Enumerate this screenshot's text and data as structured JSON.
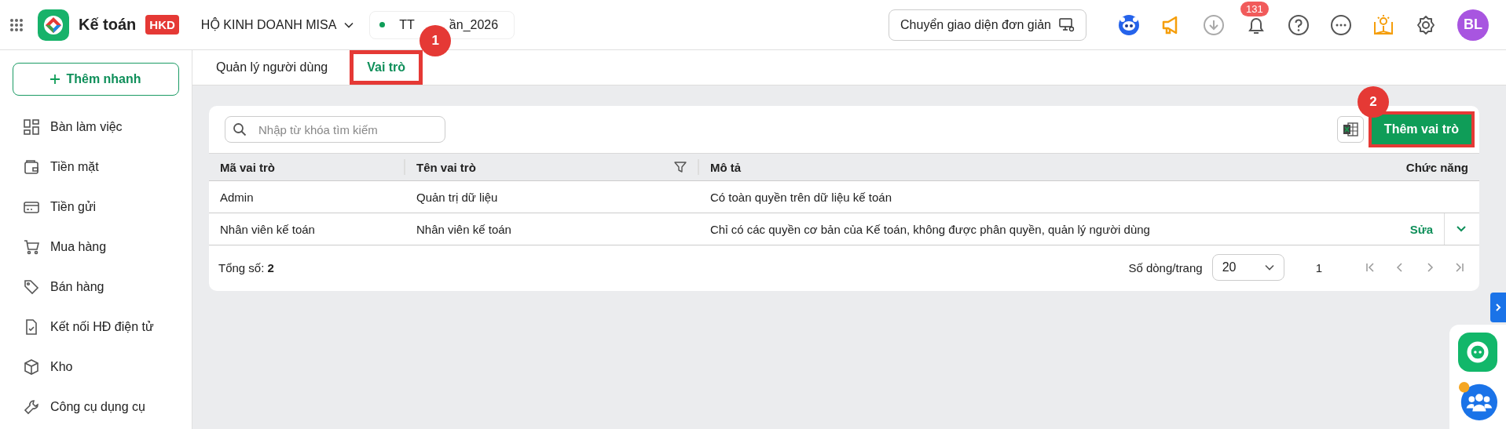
{
  "header": {
    "app_name": "Kế toán",
    "app_badge": "HKD",
    "company": "HỘ KINH DOANH MISA",
    "database": {
      "text_start": "TT",
      "text_end": "ần_2026",
      "marker": "1"
    },
    "simple_ui_button": "Chuyển giao diện đơn giản",
    "notification_count": "131",
    "avatar": "BL"
  },
  "sidebar": {
    "quick_add": "Thêm nhanh",
    "items": [
      {
        "label": "Bàn làm việc",
        "kind": "dashboard"
      },
      {
        "label": "Tiền mặt",
        "kind": "wallet"
      },
      {
        "label": "Tiền gửi",
        "kind": "card"
      },
      {
        "label": "Mua hàng",
        "kind": "cart"
      },
      {
        "label": "Bán hàng",
        "kind": "tag"
      },
      {
        "label": "Kết nối HĐ điện tử",
        "kind": "document"
      },
      {
        "label": "Kho",
        "kind": "box"
      },
      {
        "label": "Công cụ dụng cụ",
        "kind": "tool"
      }
    ]
  },
  "tabs": [
    {
      "label": "Quản lý người dùng",
      "selected": false,
      "highlighted": false
    },
    {
      "label": "Vai trò",
      "selected": true,
      "highlighted": true
    }
  ],
  "toolbar": {
    "search": {
      "placeholder": "Nhập từ khóa tìm kiếm"
    },
    "add_button": {
      "label": "Thêm vai trò",
      "highlighted": true,
      "marker": "2"
    }
  },
  "table": {
    "columns": [
      {
        "label": "Mã vai trò",
        "filter": false
      },
      {
        "label": "Tên vai trò",
        "filter": true
      },
      {
        "label": "Mô tả",
        "filter": false
      },
      {
        "label": "Chức năng",
        "filter": false
      }
    ],
    "rows": [
      {
        "code": "Admin",
        "name": "Quản trị dữ liệu",
        "description": "Có toàn quyền trên dữ liệu kế toán"
      },
      {
        "code": "Nhân viên kế toán",
        "name": "Nhân viên kế toán",
        "description": "Chỉ có các quyền cơ bản của Kế toán, không được phân quyền, quản lý người dùng",
        "action": "Sửa"
      }
    ]
  },
  "footer": {
    "total": "Tổng số: **2**",
    "page_size_label": "Số dòng/trang",
    "page_size": "20",
    "page": "1"
  }
}
